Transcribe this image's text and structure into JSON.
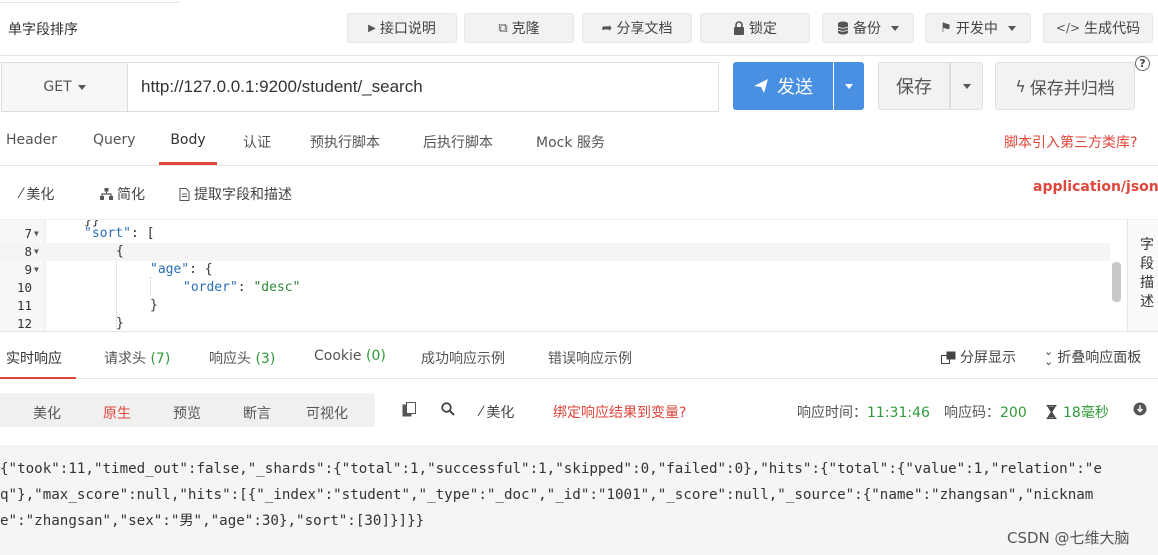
{
  "header": {
    "title": "单字段排序",
    "buttons": {
      "api_doc": "接口说明",
      "clone": "克隆",
      "share_doc": "分享文档",
      "lock": "锁定",
      "backup": "备份",
      "status": "开发中",
      "gen_code": "生成代码"
    }
  },
  "request": {
    "method": "GET",
    "url": "http://127.0.0.1:9200/student/_search",
    "send_label": "发送",
    "save_label": "保存",
    "save_archive_label": "保存并归档",
    "help": "?"
  },
  "request_tabs": {
    "items": [
      "Header",
      "Query",
      "Body",
      "认证",
      "预执行脚本",
      "后执行脚本",
      "Mock 服务"
    ],
    "active": "Body",
    "third_party_link": "脚本引入第三方类库?"
  },
  "body_toolbar": {
    "beautify": "美化",
    "simplify": "简化",
    "extract": "提取字段和描述",
    "content_type": "application/json"
  },
  "editor": {
    "lines": [
      {
        "no": "",
        "text": "}}"
      },
      {
        "no": "7",
        "key": "\"sort\"",
        "rest": ": ["
      },
      {
        "no": "8",
        "text": "{"
      },
      {
        "no": "9",
        "key": "\"age\"",
        "rest": ": {"
      },
      {
        "no": "10",
        "key": "\"order\"",
        "sep": ": ",
        "val": "\"desc\""
      },
      {
        "no": "11",
        "text": "}"
      },
      {
        "no": "12",
        "text": "}"
      }
    ],
    "field_desc": "字段描述"
  },
  "response_tabs": {
    "realtime": "实时响应",
    "req_headers": "请求头",
    "req_headers_count": "(7)",
    "resp_headers": "响应头",
    "resp_headers_count": "(3)",
    "cookie": "Cookie",
    "cookie_count": "(0)",
    "success_example": "成功响应示例",
    "error_example": "错误响应示例",
    "split_view": "分屏显示",
    "collapse": "折叠响应面板"
  },
  "response_toolbar": {
    "views": [
      "美化",
      "原生",
      "预览",
      "断言",
      "可视化"
    ],
    "active_view": "原生",
    "beautify": "美化",
    "bind_var": "绑定响应结果到变量?",
    "time_label": "响应时间：",
    "time_value": "11:31:46",
    "code_label": "响应码：",
    "code_value": "200",
    "duration": "18毫秒"
  },
  "response_body": {
    "lines": [
      "{\"took\":11,\"timed_out\":false,\"_shards\":{\"total\":1,\"successful\":1,\"skipped\":0,\"failed\":0},\"hits\":{\"total\":{\"value\":1,\"relation\":\"e",
      "q\"},\"max_score\":null,\"hits\":[{\"_index\":\"student\",\"_type\":\"_doc\",\"_id\":\"1001\",\"_score\":null,\"_source\":{\"name\":\"zhangsan\",\"nicknam",
      "e\":\"zhangsan\",\"sex\":\"男\",\"age\":30},\"sort\":[30]}]}}"
    ]
  },
  "watermark": "CSDN @七维大脑"
}
